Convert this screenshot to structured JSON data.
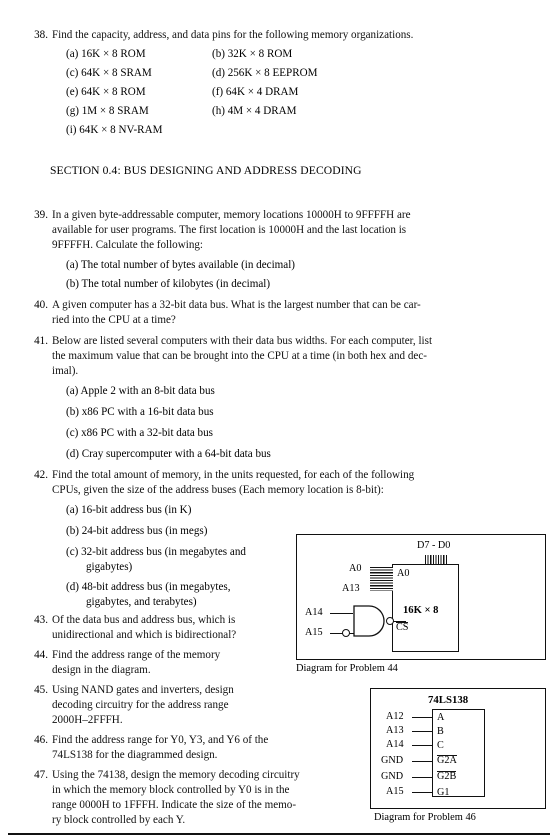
{
  "problems": {
    "p38": {
      "number": "38.",
      "stem": "Find the capacity, address, and data pins for the following memory organizations.",
      "items": [
        "(a) 16K × 8 ROM",
        "(b) 32K × 8 ROM",
        "(c) 64K × 8 SRAM",
        "(d) 256K × 8 EEPROM",
        "(e) 64K × 8 ROM",
        "(f) 64K × 4 DRAM",
        "(g) 1M × 8 SRAM",
        "(h) 4M × 4 DRAM",
        "(i) 64K × 8 NV-RAM"
      ]
    },
    "p39": {
      "number": "39.",
      "stem_lines": [
        "In a given byte-addressable computer, memory locations 10000H to 9FFFFH are",
        "available for user programs. The first location is 10000H and the last location is",
        "9FFFFH. Calculate the following:"
      ],
      "items": [
        "(a)  The total number of bytes available (in decimal)",
        "(b)  The total number of kilobytes (in decimal)"
      ]
    },
    "p40": {
      "number": "40.",
      "stem_lines": [
        "A given computer has a 32-bit data bus. What is the largest number that can be car-",
        "ried into the CPU at a time?"
      ]
    },
    "p41": {
      "number": "41.",
      "stem_lines": [
        "Below are listed several computers with their data bus widths. For each computer, list",
        "the maximum value that can be brought into the CPU at a time (in both hex and dec-",
        "imal)."
      ],
      "items": [
        "(a) Apple 2 with an 8-bit data bus",
        "(b) x86 PC with a 16-bit data bus",
        "(c) x86 PC with a 32-bit data bus",
        "(d) Cray supercomputer with a 64-bit data bus"
      ]
    },
    "p42": {
      "number": "42.",
      "stem_lines": [
        "Find the total amount of memory, in the units requested, for each of the following",
        "CPUs, given the size of the address buses (Each memory location is 8-bit):"
      ],
      "items": [
        "(a) 16-bit address bus (in K)",
        "(b) 24-bit address bus (in megs)"
      ],
      "item_c_line1": "(c) 32-bit address bus (in megabytes and",
      "item_c_line2": "gigabytes)",
      "item_d_line1": "(d)  48-bit address bus  (in megabytes,",
      "item_d_line2": "gigabytes, and terabytes)"
    },
    "p43": {
      "number": "43.",
      "lines": [
        "Of the data bus and address bus, which is",
        "unidirectional and which is bidirectional?"
      ]
    },
    "p44": {
      "number": "44.",
      "lines": [
        "Find  the  address  range  of  the  memory",
        "design in the diagram."
      ]
    },
    "p45": {
      "number": "45.",
      "lines": [
        "Using NAND gates and inverters, design",
        "decoding   circuitry   for   the   address   range",
        "2000H–2FFFH."
      ]
    },
    "p46": {
      "number": "46.",
      "lines": [
        "Find  the  address  range  for  Y0,  Y3,  and  Y6  of  the",
        "74LS138 for the diagrammed design."
      ]
    },
    "p47": {
      "number": "47.",
      "lines": [
        "Using the 74138, design the memory decoding circuitry",
        "in which the memory block controlled by Y0 is in the",
        "range 0000H to 1FFFH.  Indicate the size of the memo-",
        "ry block controlled by each Y."
      ]
    }
  },
  "section": {
    "heading": "SECTION 0.4: BUS DESIGNING AND ADDRESS DECODING"
  },
  "diagram44": {
    "caption": "Diagram for Problem 44",
    "data_bus_label": "D7 - D0",
    "addr_top_label": "A0",
    "addr_bottom_label": "A13",
    "chip_addr_label": "A0",
    "chip_size": "16K × 8",
    "chip_cs": "CS",
    "nand_input_top": "A14",
    "nand_input_bottom": "A15"
  },
  "diagram46": {
    "caption": "Diagram for Problem 46",
    "chip_title": "74LS138",
    "pins": [
      {
        "signal": "A12",
        "pin": "A",
        "overbar": false
      },
      {
        "signal": "A13",
        "pin": "B",
        "overbar": false
      },
      {
        "signal": "A14",
        "pin": "C",
        "overbar": false
      },
      {
        "signal": "GND",
        "pin": "G2A",
        "overbar": true
      },
      {
        "signal": "GND",
        "pin": "G2B",
        "overbar": true
      },
      {
        "signal": "A15",
        "pin": "G1",
        "overbar": false
      }
    ]
  }
}
